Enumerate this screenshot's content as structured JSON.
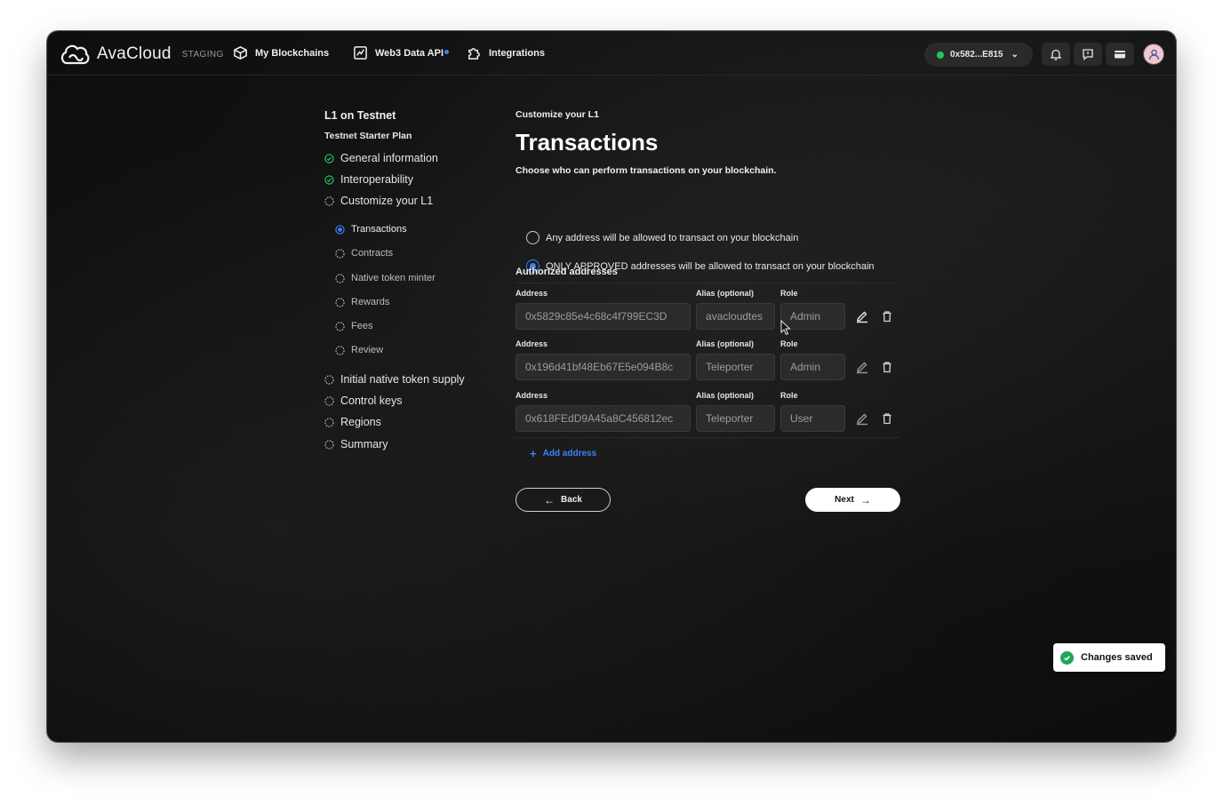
{
  "app": {
    "name": "AvaCloud",
    "env": "STAGING"
  },
  "nav": [
    {
      "label": "My Blockchains",
      "icon": "cube-icon"
    },
    {
      "label": "Web3 Data API",
      "icon": "chart-icon"
    },
    {
      "label": "Integrations",
      "icon": "puzzle-icon"
    }
  ],
  "wallet": {
    "address": "0x582...E815",
    "status_color": "#22c55e"
  },
  "sidebar": {
    "title": "L1 on Testnet",
    "plan": "Testnet Starter Plan",
    "steps": [
      {
        "label": "General information",
        "state": "done"
      },
      {
        "label": "Interoperability",
        "state": "done"
      },
      {
        "label": "Customize your L1",
        "state": "pending"
      },
      {
        "label": "Initial native token supply",
        "state": "pending"
      },
      {
        "label": "Control keys",
        "state": "pending"
      },
      {
        "label": "Regions",
        "state": "pending"
      },
      {
        "label": "Summary",
        "state": "pending"
      }
    ],
    "substeps": [
      {
        "label": "Transactions",
        "state": "active"
      },
      {
        "label": "Contracts",
        "state": "pending"
      },
      {
        "label": "Native token minter",
        "state": "pending"
      },
      {
        "label": "Rewards",
        "state": "pending"
      },
      {
        "label": "Fees",
        "state": "pending"
      },
      {
        "label": "Review",
        "state": "pending"
      }
    ]
  },
  "main": {
    "eyebrow": "Customize your L1",
    "title": "Transactions",
    "description": "Choose who can perform transactions on your blockchain.",
    "options": [
      {
        "label": "Any address will be allowed to transact on your blockchain",
        "checked": false
      },
      {
        "label": "ONLY APPROVED addresses will be allowed to transact on your blockchain",
        "checked": true
      }
    ],
    "section_title": "Authorized addresses",
    "labels": {
      "address": "Address",
      "alias": "Alias (optional)",
      "role": "Role"
    },
    "rows": [
      {
        "address": "0x5829c85e4c68c4f799EC3D",
        "alias": "avacloudtes",
        "role": "Admin"
      },
      {
        "address": "0x196d41bf48Eb67E5e094B8c",
        "alias": "Teleporter",
        "role": "Admin"
      },
      {
        "address": "0x618FEdD9A45a8C456812ec",
        "alias": "Teleporter",
        "role": "User"
      }
    ],
    "add_label": "Add address",
    "back_label": "Back",
    "next_label": "Next"
  },
  "toast": {
    "message": "Changes saved"
  },
  "colors": {
    "accent": "#3b82f6",
    "success": "#22c55e"
  }
}
